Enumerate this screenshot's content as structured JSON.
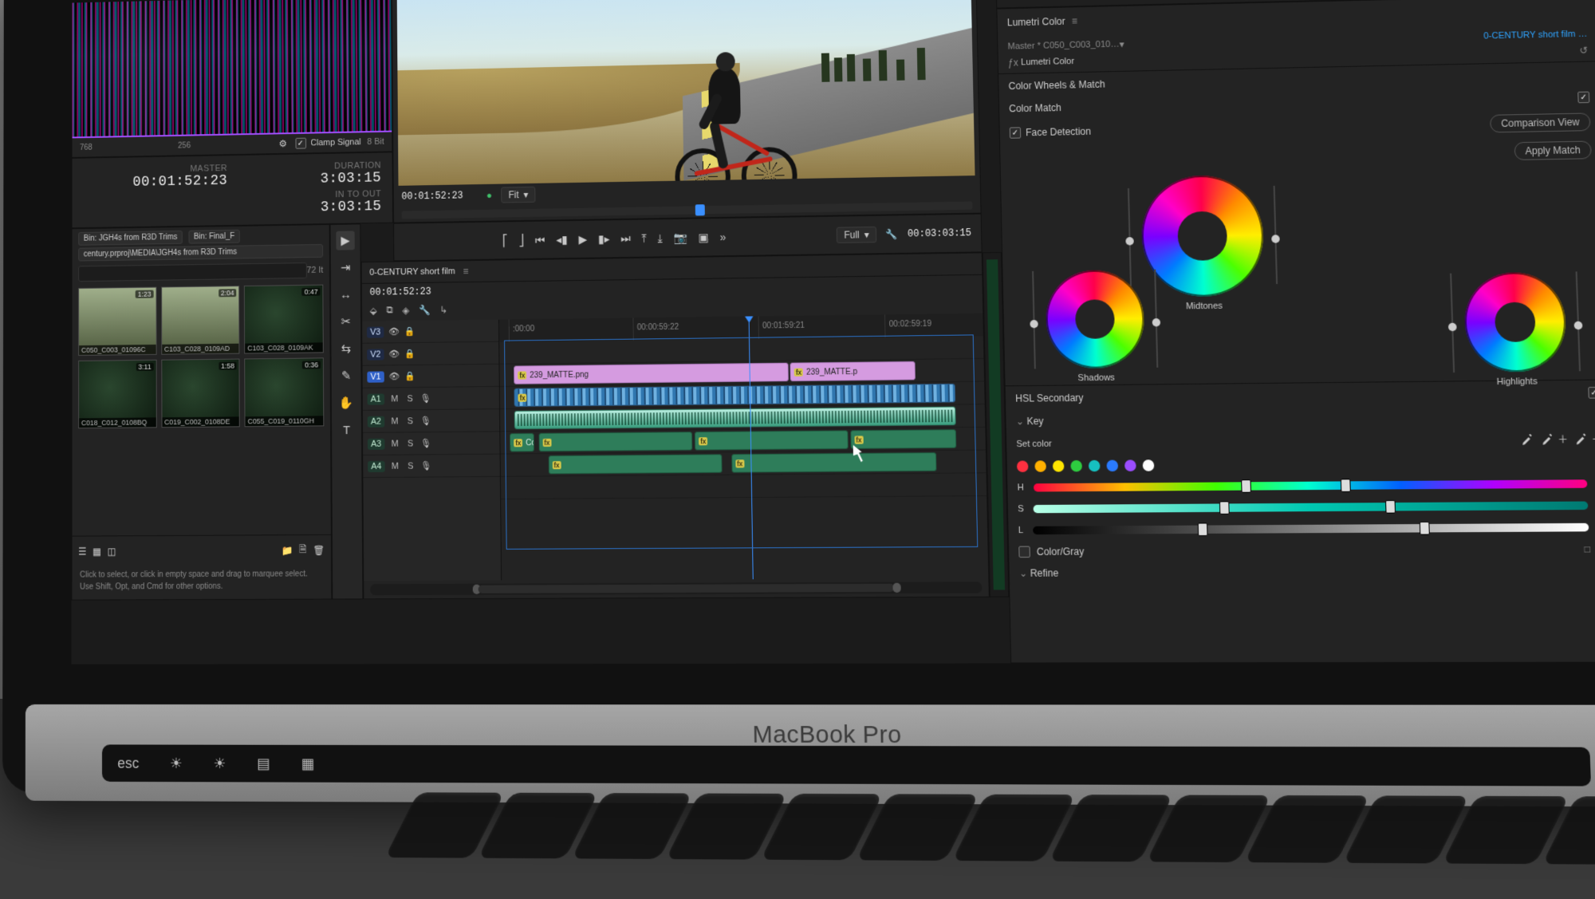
{
  "device": {
    "brand": "MacBook Pro"
  },
  "header_icons": [
    "share-icon",
    "beaker-icon",
    "chat-icon"
  ],
  "lumetri": {
    "panel_title": "Lumetri Color",
    "master_label": "Master * C050_C003_010…",
    "sequence_name": "0-CENTURY short film …",
    "fx_label": "Lumetri Color",
    "section_wheels": "Color Wheels & Match",
    "color_match_label": "Color Match",
    "face_detection_label": "Face Detection",
    "face_detection_checked": true,
    "comparison_btn": "Comparison View",
    "apply_btn": "Apply Match",
    "wheels": {
      "midtones": "Midtones",
      "shadows": "Shadows",
      "highlights": "Highlights"
    },
    "hsl": {
      "section": "HSL Secondary",
      "key_label": "Key",
      "set_color_label": "Set color",
      "h": "H",
      "s": "S",
      "l": "L",
      "color_gray_label": "Color/Gray",
      "refine_label": "Refine",
      "swatches": [
        "#ff3040",
        "#ffb000",
        "#ffe600",
        "#2ecc40",
        "#16c0c0",
        "#2a7bff",
        "#9b4dff",
        "#ffffff"
      ]
    }
  },
  "source": {
    "scope_markers": [
      "768",
      "256"
    ],
    "clamp_label": "Clamp Signal",
    "clamp_checked": true,
    "bit_depth": "8 Bit",
    "master_label": "MASTER",
    "master_tc": "00:01:52:23",
    "duration_label": "DURATION",
    "duration_val": "3:03:15",
    "intoout_label": "IN TO OUT",
    "intoout_val": "3:03:15"
  },
  "project": {
    "crumbs": [
      "Bin: JGH4s from R3D Trims",
      "Bin: Final_F"
    ],
    "crumbs2": [
      "century.prproj\\MEDIA\\JGH4s from R3D Trims"
    ],
    "count": "72 It",
    "hint1": "Click to select, or click in empty space and drag to marquee select.",
    "hint2": "Use Shift, Opt, and Cmd for other options.",
    "clips": [
      {
        "name": "C050_C003_01096C",
        "len": "1:23"
      },
      {
        "name": "C103_C028_0109AD",
        "len": "2:04"
      },
      {
        "name": "C103_C028_0109AK",
        "len": "0:47"
      },
      {
        "name": "C018_C012_0108BQ",
        "len": "3:11"
      },
      {
        "name": "C019_C002_0108DE",
        "len": "1:58"
      },
      {
        "name": "C055_C019_0110GH",
        "len": "0:36"
      }
    ]
  },
  "program": {
    "tc_left": "00:01:52:23",
    "fit_label": "Fit",
    "full_label": "Full",
    "tc_right": "00:03:03:15"
  },
  "timeline": {
    "title": "0-CENTURY short film",
    "tc": "00:01:52:23",
    "ruler": [
      {
        "pos": 2,
        "label": ":00:00"
      },
      {
        "pos": 28,
        "label": "00:00:59:22"
      },
      {
        "pos": 54,
        "label": "00:01:59:21"
      },
      {
        "pos": 80,
        "label": "00:02:59:19"
      }
    ],
    "tracks_v": [
      "V3",
      "V2",
      "V1"
    ],
    "tracks_a": [
      "A1",
      "A2",
      "A3",
      "A4"
    ],
    "clips_v2": [
      {
        "start": 3,
        "end": 60,
        "label": "239_MATTE.png"
      },
      {
        "start": 60.4,
        "end": 86,
        "label": "239_MATTE.p"
      }
    ],
    "clips_v1": [
      {
        "start": 3,
        "end": 94,
        "label": ""
      }
    ],
    "clips_a1": [
      {
        "start": 3,
        "end": 94,
        "label": ""
      }
    ],
    "clips_a2": [
      {
        "start": 2,
        "end": 7,
        "label": "Consta…"
      },
      {
        "start": 8,
        "end": 40,
        "label": ""
      },
      {
        "start": 40.5,
        "end": 72,
        "label": ""
      },
      {
        "start": 72.5,
        "end": 94,
        "label": ""
      }
    ],
    "clips_a3": [
      {
        "start": 10,
        "end": 46,
        "label": ""
      },
      {
        "start": 48,
        "end": 90,
        "label": ""
      }
    ],
    "playhead_pct": 52
  }
}
